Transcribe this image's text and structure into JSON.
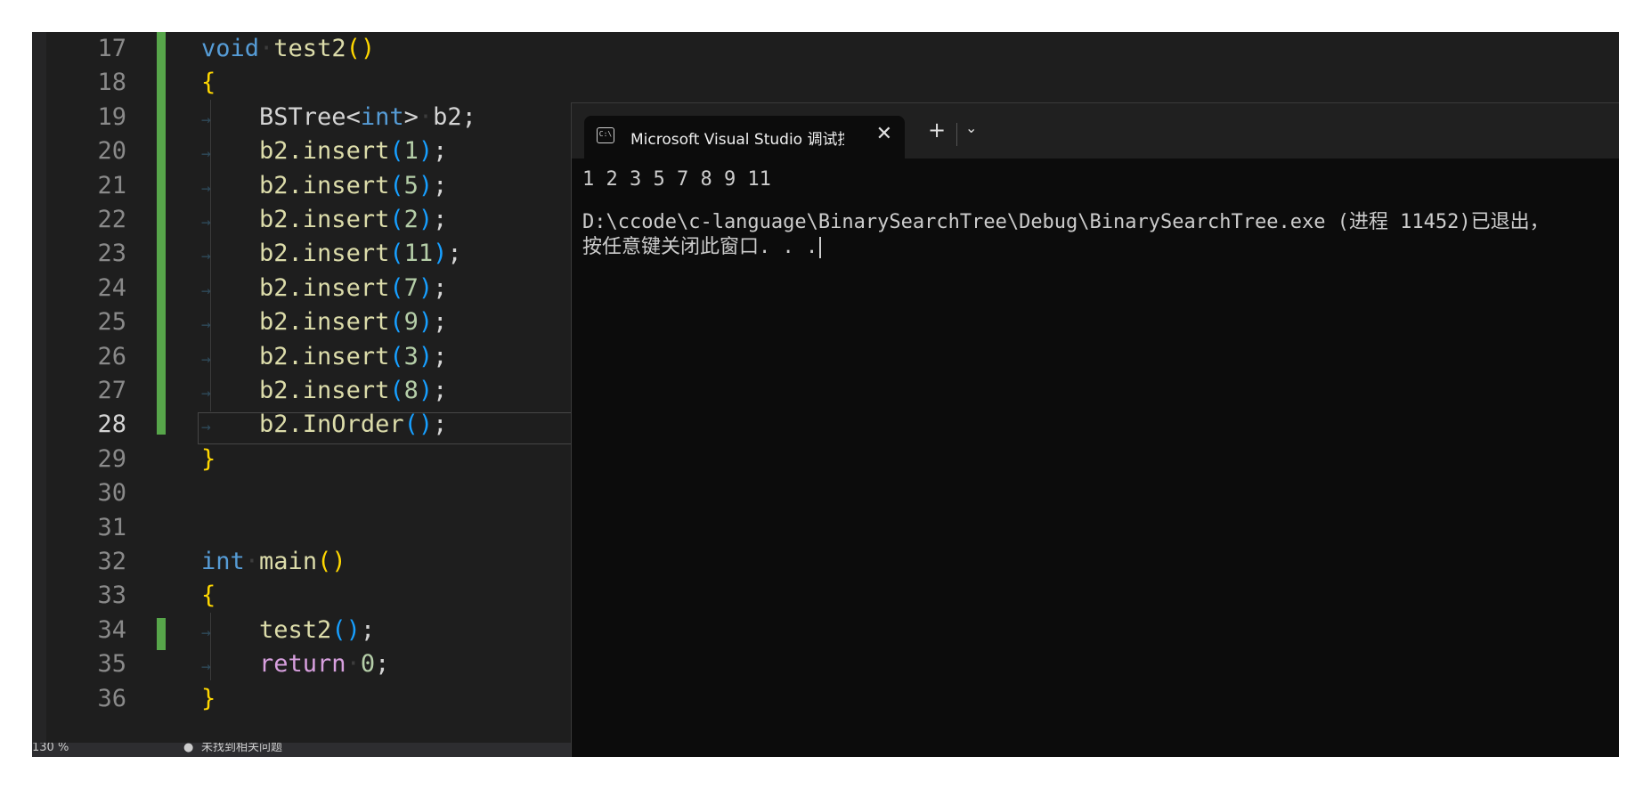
{
  "editor": {
    "line_numbers": [
      "17",
      "18",
      "19",
      "20",
      "21",
      "22",
      "23",
      "24",
      "25",
      "26",
      "27",
      "28",
      "29",
      "30",
      "31",
      "32",
      "33",
      "34",
      "35",
      "36"
    ],
    "current_line": "28",
    "code": {
      "l17_kw": "void",
      "l17_fn": "test2",
      "l17_paren": "()",
      "l18_brace": "{",
      "l19_type": "BSTree",
      "l19_lt": "<",
      "l19_kw": "int",
      "l19_gt": ">",
      "l19_var": "b2;",
      "inserts": [
        {
          "call": "b2.insert",
          "arg": "1"
        },
        {
          "call": "b2.insert",
          "arg": "5"
        },
        {
          "call": "b2.insert",
          "arg": "2"
        },
        {
          "call": "b2.insert",
          "arg": "11"
        },
        {
          "call": "b2.insert",
          "arg": "7"
        },
        {
          "call": "b2.insert",
          "arg": "9"
        },
        {
          "call": "b2.insert",
          "arg": "3"
        },
        {
          "call": "b2.insert",
          "arg": "8"
        }
      ],
      "l28_call": "b2.InOrder",
      "l28_paren": "()",
      "semi": ";",
      "l29_brace": "}",
      "l32_kw": "int",
      "l32_fn": "main",
      "l32_paren": "()",
      "l33_brace": "{",
      "l34_fn": "test2",
      "l34_paren": "()",
      "l35_kw": "return",
      "l35_num": "0",
      "l36_brace": "}",
      "open_paren": "(",
      "close_paren": ")"
    }
  },
  "terminal": {
    "tab_title": "Microsoft Visual Studio 调试控制台",
    "icon_text": "C:\\",
    "close_glyph": "✕",
    "new_tab_glyph": "+",
    "dropdown_glyph": "⌄",
    "output": [
      "1 2 3 5 7 8 9 11",
      "",
      "D:\\ccode\\c-language\\BinarySearchTree\\Debug\\BinarySearchTree.exe (进程 11452)已退出，",
      "按任意键关闭此窗口. . ."
    ]
  },
  "statusbar": {
    "zoom": "130 %",
    "issues": "未找到相关问题"
  },
  "colors": {
    "editor_bg": "#1e1e1e",
    "terminal_bg": "#0c0c0c",
    "change_bar": "#57a64a",
    "keyword": "#569cd6",
    "control_keyword": "#d8a0df",
    "function": "#dcdcaa",
    "number": "#b5cea8",
    "brace": "#ffd700",
    "paren": "#179fff"
  }
}
